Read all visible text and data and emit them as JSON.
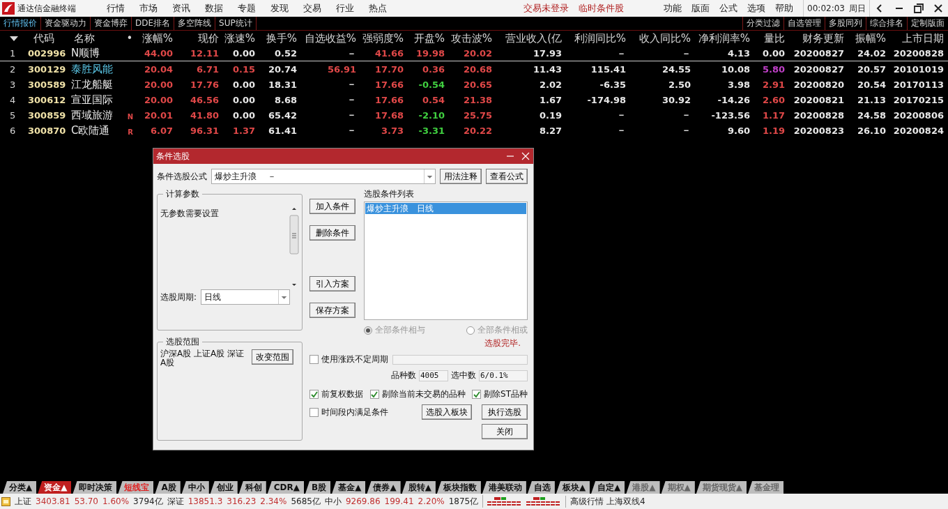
{
  "app": {
    "title": "通达信金融终端"
  },
  "menus": [
    "行情",
    "市场",
    "资讯",
    "数据",
    "专题",
    "发现",
    "交易",
    "行业",
    "热点"
  ],
  "notices": [
    "交易未登录",
    "临时条件股"
  ],
  "right_menus": [
    "功能",
    "版面",
    "公式",
    "选项",
    "帮助"
  ],
  "clock": {
    "time": "00:02:03",
    "weekday": "周日"
  },
  "subtabs": [
    {
      "label": "行情报价",
      "selected": true
    },
    {
      "label": "资金驱动力",
      "selected": false
    },
    {
      "label": "资金博弈",
      "selected": false
    },
    {
      "label": "DDE排名",
      "selected": false
    },
    {
      "label": "多空阵线",
      "selected": false
    },
    {
      "label": "SUP统计",
      "selected": false
    }
  ],
  "right_tabs": [
    "分类过滤",
    "自选管理",
    "多股同列",
    "综合排名",
    "定制版面"
  ],
  "table": {
    "flag_header": "•",
    "columns": [
      "代码",
      "名称",
      "涨幅%",
      "现价",
      "涨速%",
      "换手%",
      "自选收益%",
      "强弱度%",
      "开盘%",
      "攻击波%",
      "营业收入(亿",
      "利润同比%",
      "收入同比%",
      "净利润率%",
      "量比",
      "财务更新",
      "振幅%",
      "上市日期"
    ],
    "rows": [
      {
        "index": "1",
        "cells": [
          {
            "text": "002996",
            "color": "#f0e2a8"
          },
          {
            "text": "N顺博",
            "color": "#e8e8e8"
          },
          {
            "text": "44.00",
            "color": "#e04848"
          },
          {
            "text": "12.11",
            "color": "#e04848"
          },
          {
            "text": "0.00",
            "color": "#e8e8e8"
          },
          {
            "text": "0.52",
            "color": "#e8e8e8"
          },
          {
            "text": "－",
            "color": "#e8e8e8"
          },
          {
            "text": "41.66",
            "color": "#e04848"
          },
          {
            "text": "19.98",
            "color": "#e04848"
          },
          {
            "text": "20.02",
            "color": "#e04848"
          },
          {
            "text": "17.93",
            "color": "#e8e8e8"
          },
          {
            "text": "－",
            "color": "#e8e8e8"
          },
          {
            "text": "－",
            "color": "#e8e8e8"
          },
          {
            "text": "4.13",
            "color": "#e8e8e8"
          },
          {
            "text": "0.00",
            "color": "#e8e8e8"
          },
          {
            "text": "20200827",
            "color": "#e8e8e8"
          },
          {
            "text": "24.02",
            "color": "#e8e8e8"
          },
          {
            "text": "20200828",
            "color": "#e8e8e8"
          }
        ]
      },
      {
        "index": "2",
        "cells": [
          {
            "text": "300129",
            "color": "#f0e2a8"
          },
          {
            "text": "泰胜风能",
            "color": "#5cc8e8"
          },
          {
            "text": "20.04",
            "color": "#e04848"
          },
          {
            "text": "6.71",
            "color": "#e04848"
          },
          {
            "text": "0.15",
            "color": "#e04848"
          },
          {
            "text": "20.74",
            "color": "#e8e8e8"
          },
          {
            "text": "56.91",
            "color": "#e04848"
          },
          {
            "text": "17.70",
            "color": "#e04848"
          },
          {
            "text": "0.36",
            "color": "#e04848"
          },
          {
            "text": "20.68",
            "color": "#e04848"
          },
          {
            "text": "11.43",
            "color": "#e8e8e8"
          },
          {
            "text": "115.41",
            "color": "#e8e8e8"
          },
          {
            "text": "24.55",
            "color": "#e8e8e8"
          },
          {
            "text": "10.08",
            "color": "#e8e8e8"
          },
          {
            "text": "5.80",
            "color": "#c040c8"
          },
          {
            "text": "20200827",
            "color": "#e8e8e8"
          },
          {
            "text": "20.57",
            "color": "#e8e8e8"
          },
          {
            "text": "20101019",
            "color": "#e8e8e8"
          }
        ]
      },
      {
        "index": "3",
        "cells": [
          {
            "text": "300589",
            "color": "#f0e2a8"
          },
          {
            "text": "江龙船艇",
            "color": "#e8e8e8"
          },
          {
            "text": "20.00",
            "color": "#e04848"
          },
          {
            "text": "17.76",
            "color": "#e04848"
          },
          {
            "text": "0.00",
            "color": "#e8e8e8"
          },
          {
            "text": "18.31",
            "color": "#e8e8e8"
          },
          {
            "text": "－",
            "color": "#e8e8e8"
          },
          {
            "text": "17.66",
            "color": "#e04848"
          },
          {
            "text": "-0.54",
            "color": "#40d040"
          },
          {
            "text": "20.65",
            "color": "#e04848"
          },
          {
            "text": "2.02",
            "color": "#e8e8e8"
          },
          {
            "text": "-6.35",
            "color": "#e8e8e8"
          },
          {
            "text": "2.50",
            "color": "#e8e8e8"
          },
          {
            "text": "3.98",
            "color": "#e8e8e8"
          },
          {
            "text": "2.91",
            "color": "#e04848"
          },
          {
            "text": "20200820",
            "color": "#e8e8e8"
          },
          {
            "text": "20.54",
            "color": "#e8e8e8"
          },
          {
            "text": "20170113",
            "color": "#e8e8e8"
          }
        ]
      },
      {
        "index": "4",
        "cells": [
          {
            "text": "300612",
            "color": "#f0e2a8"
          },
          {
            "text": "宣亚国际",
            "color": "#e8e8e8"
          },
          {
            "text": "20.00",
            "color": "#e04848"
          },
          {
            "text": "46.56",
            "color": "#e04848"
          },
          {
            "text": "0.00",
            "color": "#e8e8e8"
          },
          {
            "text": "8.68",
            "color": "#e8e8e8"
          },
          {
            "text": "－",
            "color": "#e8e8e8"
          },
          {
            "text": "17.66",
            "color": "#e04848"
          },
          {
            "text": "0.54",
            "color": "#e04848"
          },
          {
            "text": "21.38",
            "color": "#e04848"
          },
          {
            "text": "1.67",
            "color": "#e8e8e8"
          },
          {
            "text": "-174.98",
            "color": "#e8e8e8"
          },
          {
            "text": "30.92",
            "color": "#e8e8e8"
          },
          {
            "text": "-14.26",
            "color": "#e8e8e8"
          },
          {
            "text": "2.60",
            "color": "#e04848"
          },
          {
            "text": "20200821",
            "color": "#e8e8e8"
          },
          {
            "text": "21.13",
            "color": "#e8e8e8"
          },
          {
            "text": "20170215",
            "color": "#e8e8e8"
          }
        ]
      },
      {
        "index": "5",
        "flag": "N",
        "cells": [
          {
            "text": "300859",
            "color": "#f0e2a8"
          },
          {
            "text": "西域旅游",
            "color": "#e8e8e8"
          },
          {
            "text": "20.01",
            "color": "#e04848"
          },
          {
            "text": "41.80",
            "color": "#e04848"
          },
          {
            "text": "0.00",
            "color": "#e8e8e8"
          },
          {
            "text": "65.42",
            "color": "#e8e8e8"
          },
          {
            "text": "－",
            "color": "#e8e8e8"
          },
          {
            "text": "17.68",
            "color": "#e04848"
          },
          {
            "text": "-2.10",
            "color": "#40d040"
          },
          {
            "text": "25.75",
            "color": "#e04848"
          },
          {
            "text": "0.19",
            "color": "#e8e8e8"
          },
          {
            "text": "－",
            "color": "#e8e8e8"
          },
          {
            "text": "－",
            "color": "#e8e8e8"
          },
          {
            "text": "-123.56",
            "color": "#e8e8e8"
          },
          {
            "text": "1.17",
            "color": "#e04848"
          },
          {
            "text": "20200828",
            "color": "#e8e8e8"
          },
          {
            "text": "24.58",
            "color": "#e8e8e8"
          },
          {
            "text": "20200806",
            "color": "#e8e8e8"
          }
        ]
      },
      {
        "index": "6",
        "flag": "R",
        "cells": [
          {
            "text": "300870",
            "color": "#f0e2a8"
          },
          {
            "text": "C欧陆通",
            "color": "#e8e8e8"
          },
          {
            "text": "6.07",
            "color": "#e04848"
          },
          {
            "text": "96.31",
            "color": "#e04848"
          },
          {
            "text": "1.37",
            "color": "#e04848"
          },
          {
            "text": "61.41",
            "color": "#e8e8e8"
          },
          {
            "text": "－",
            "color": "#e8e8e8"
          },
          {
            "text": "3.73",
            "color": "#e04848"
          },
          {
            "text": "-3.31",
            "color": "#40d040"
          },
          {
            "text": "20.22",
            "color": "#e04848"
          },
          {
            "text": "8.27",
            "color": "#e8e8e8"
          },
          {
            "text": "－",
            "color": "#e8e8e8"
          },
          {
            "text": "－",
            "color": "#e8e8e8"
          },
          {
            "text": "9.60",
            "color": "#e8e8e8"
          },
          {
            "text": "1.19",
            "color": "#e04848"
          },
          {
            "text": "20200823",
            "color": "#e8e8e8"
          },
          {
            "text": "26.10",
            "color": "#e8e8e8"
          },
          {
            "text": "20200824",
            "color": "#e8e8e8"
          }
        ]
      }
    ]
  },
  "dialog": {
    "title": "条件选股",
    "formula": {
      "label": "条件选股公式",
      "value": "爆炒主升浪　 －"
    },
    "top_buttons": [
      "用法注释",
      "查看公式"
    ],
    "params": {
      "legend": "计算参数",
      "message": "无参数需要设置",
      "period_label": "选股周期:",
      "period_value": "日线"
    },
    "scope": {
      "legend": "选股范围",
      "text": "沪深A股 上证A股 深证A股",
      "button": "改变范围"
    },
    "actions": [
      "加入条件",
      "删除条件",
      "引入方案",
      "保存方案"
    ],
    "list": {
      "label": "选股条件列表",
      "items": [
        {
          "text": "爆炒主升浪　日线",
          "selected": true
        }
      ]
    },
    "logic": {
      "disabled": true,
      "options": [
        {
          "label": "全部条件相与",
          "selected": true
        },
        {
          "label": "全部条件相或",
          "selected": false
        }
      ]
    },
    "status": "选股完毕.",
    "variable_period": {
      "label": "使用涨跌不定周期",
      "checked": false
    },
    "counts": [
      {
        "label": "品种数",
        "value": "4005"
      },
      {
        "label": "选中数",
        "value": "6/0.1%"
      }
    ],
    "options": [
      {
        "label": "前复权数据",
        "checked": true
      },
      {
        "label": "剔除当前未交易的品种",
        "checked": true
      },
      {
        "label": "剔除ST品种",
        "checked": true
      }
    ],
    "time_condition": {
      "label": "时间段内满足条件",
      "checked": false
    },
    "bottom_buttons": [
      "选股入板块",
      "执行选股",
      "关闭"
    ]
  },
  "bottom_tabs": [
    {
      "label": "分类▲",
      "kind": "normal",
      "selected": false
    },
    {
      "label": "资金▲",
      "kind": "normal",
      "selected": true
    },
    {
      "label": "即时决策",
      "kind": "normal",
      "selected": false
    },
    {
      "label": "短线宝",
      "kind": "highlight",
      "selected": false
    },
    {
      "label": "A股",
      "kind": "normal",
      "selected": false
    },
    {
      "label": "中小",
      "kind": "normal",
      "selected": false
    },
    {
      "label": "创业",
      "kind": "normal",
      "selected": false
    },
    {
      "label": "科创",
      "kind": "normal",
      "selected": false
    },
    {
      "label": "CDR▲",
      "kind": "normal",
      "selected": false
    },
    {
      "label": "B股",
      "kind": "normal",
      "selected": false
    },
    {
      "label": "基金▲",
      "kind": "normal",
      "selected": false
    },
    {
      "label": "债券▲",
      "kind": "normal",
      "selected": false
    },
    {
      "label": "股转▲",
      "kind": "normal",
      "selected": false
    },
    {
      "label": "板块指数",
      "kind": "normal",
      "selected": false
    },
    {
      "label": "港美联动",
      "kind": "normal",
      "selected": false
    },
    {
      "label": "自选",
      "kind": "normal",
      "selected": false
    },
    {
      "label": "板块▲",
      "kind": "normal",
      "selected": false
    },
    {
      "label": "自定▲",
      "kind": "normal",
      "selected": false
    },
    {
      "label": "港股▲",
      "kind": "dim",
      "selected": false
    },
    {
      "label": "期权▲",
      "kind": "dim",
      "selected": false
    },
    {
      "label": "期货现货▲",
      "kind": "dim",
      "selected": false
    },
    {
      "label": "基金理",
      "kind": "dim",
      "selected": false
    }
  ],
  "indices": [
    {
      "name": "上证",
      "value": "3403.81",
      "change": "53.70",
      "percent": "1.60%",
      "amount": "3794亿"
    },
    {
      "name": "深证",
      "value": "13851.3",
      "change": "316.23",
      "percent": "2.34%",
      "amount": "5685亿"
    },
    {
      "name": "中小",
      "value": "9269.86",
      "change": "199.41",
      "percent": "2.20%",
      "amount": "1875亿"
    }
  ],
  "feed": "高级行情 上海双线4"
}
